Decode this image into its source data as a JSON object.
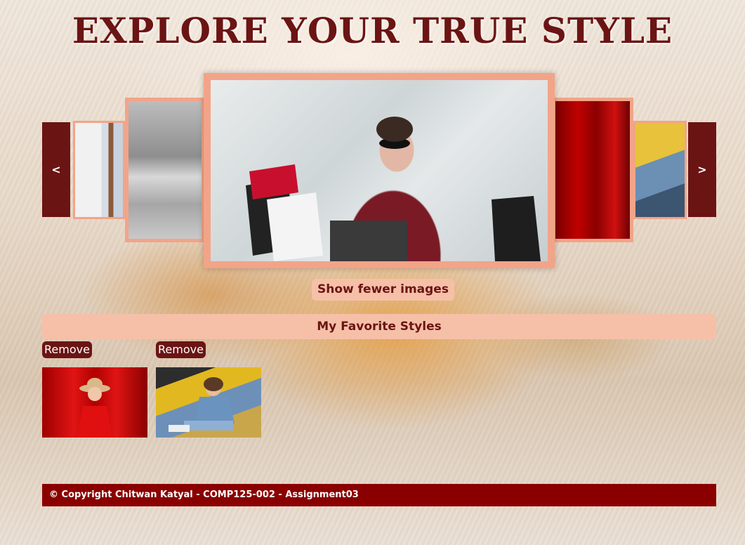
{
  "header": {
    "title": "EXPLORE YOUR TRUE STYLE"
  },
  "carousel": {
    "prev_label": "<",
    "next_label": ">",
    "toggle_label": "Show fewer images"
  },
  "favorites": {
    "heading": "My Favorite Styles",
    "items": [
      {
        "remove_label": "Remove"
      },
      {
        "remove_label": "Remove"
      }
    ]
  },
  "footer": {
    "copyright": "© Copyright Chitwan Katyal - COMP125-002 - Assignment03"
  },
  "colors": {
    "accent": "#6b1414",
    "peach": "#f6c0a8",
    "slide_border": "#f2a488",
    "footer_bg": "#8a0000"
  }
}
